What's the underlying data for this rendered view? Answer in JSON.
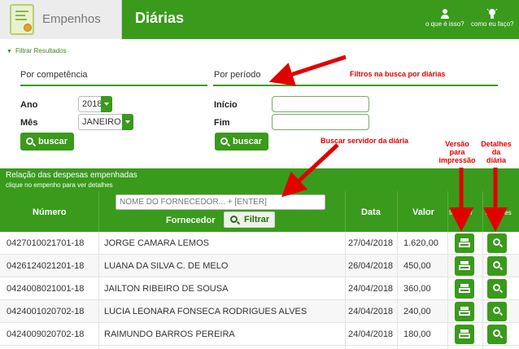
{
  "header": {
    "brand": "Empenhos",
    "title": "Diárias",
    "actions": [
      {
        "label": "o que é isso?",
        "icon": "person-icon"
      },
      {
        "label": "como eu faço?",
        "icon": "lightbulb-icon"
      }
    ]
  },
  "filter": {
    "toggle_label": "Filtrar Resultados",
    "competencia": {
      "title": "Por competência",
      "ano_label": "Ano",
      "ano_value": "2018",
      "mes_label": "Mês",
      "mes_value": "JANEIRO",
      "button": "buscar"
    },
    "periodo": {
      "title": "Por período",
      "inicio_label": "Início",
      "fim_label": "Fim",
      "button": "buscar"
    }
  },
  "annotations": {
    "filtros": "Filtros na busca por diárias",
    "buscar_servidor": "Buscar servidor da diária",
    "versao_l1": "Versão",
    "versao_l2": "para",
    "versao_l3": "impressão",
    "detalhes_l1": "Detalhes",
    "detalhes_l2": "da",
    "detalhes_l3": "diária"
  },
  "results": {
    "title": "Relação das despesas empenhadas",
    "subtitle": "clique no empenho para ver detalhes",
    "columns": {
      "numero": "Número",
      "fornecedor": "Fornecedor",
      "data": "Data",
      "valor": "Valor",
      "imprimir": "Imprimir",
      "detalhes": "Detalhes"
    },
    "search_placeholder": "NOME DO FORNECEDOR... + [ENTER]",
    "filter_button": "Filtrar",
    "rows": [
      {
        "numero": "0427010021701-18",
        "fornecedor": "JORGE CAMARA LEMOS",
        "data": "27/04/2018",
        "valor": "1.620,00"
      },
      {
        "numero": "0426124021201-18",
        "fornecedor": "LUANA DA SILVA C. DE MELO",
        "data": "26/04/2018",
        "valor": "450,00"
      },
      {
        "numero": "0424008021001-18",
        "fornecedor": "JAILTON RIBEIRO DE SOUSA",
        "data": "24/04/2018",
        "valor": "360,00"
      },
      {
        "numero": "0424001020702-18",
        "fornecedor": "LUCIA LEONARA FONSECA RODRIGUES ALVES",
        "data": "24/04/2018",
        "valor": "240,00"
      },
      {
        "numero": "0424009020702-18",
        "fornecedor": "RAIMUNDO BARROS PEREIRA",
        "data": "24/04/2018",
        "valor": "180,00"
      }
    ]
  },
  "colors": {
    "primary_green": "#3a9a1c",
    "annotation_red": "#e10000"
  }
}
